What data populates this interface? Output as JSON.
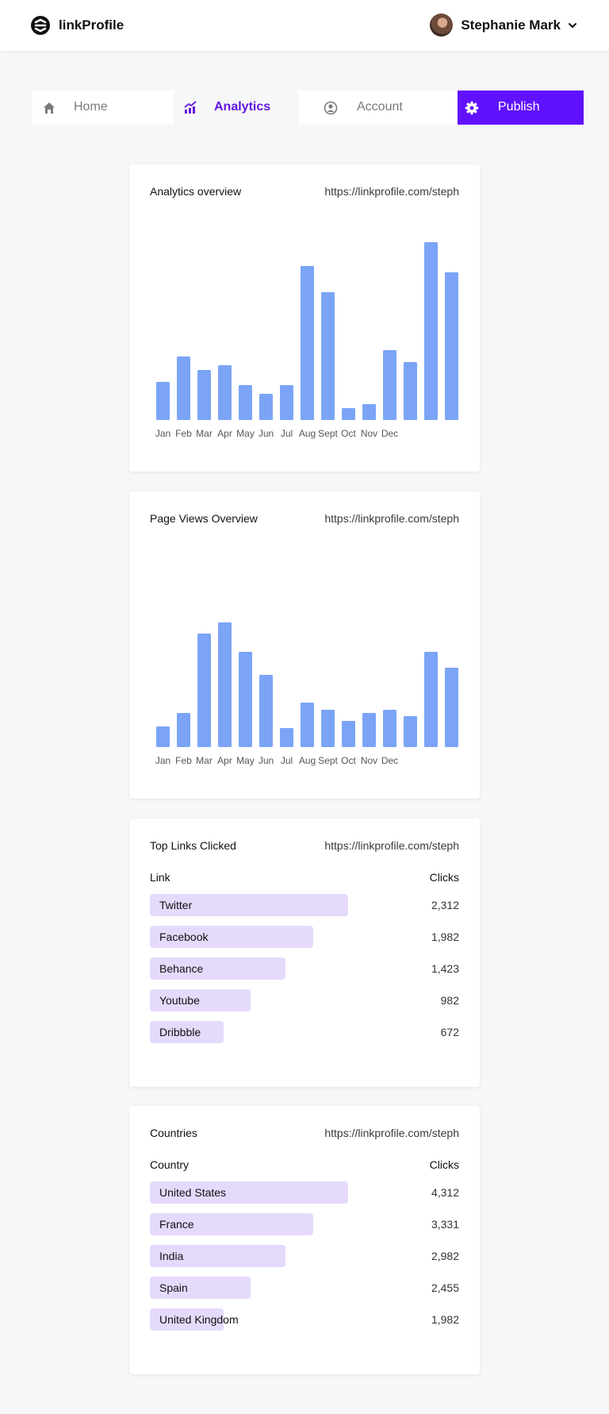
{
  "app": {
    "name": "linkProfile",
    "logo_icon": "linkprofile-logo-icon"
  },
  "user": {
    "name": "Stephanie Mark",
    "avatar_icon": "avatar",
    "menu_icon": "chevron-down-icon"
  },
  "nav": {
    "home": {
      "label": "Home",
      "icon": "home-icon"
    },
    "analytics": {
      "label": "Analytics",
      "icon": "analytics-icon"
    },
    "account": {
      "label": "Account",
      "icon": "user-circle-icon"
    },
    "publish": {
      "label": "Publish",
      "icon": "gear-icon"
    }
  },
  "colors": {
    "accent": "#6012ff",
    "bar": "#7ba4f6",
    "row_fill": "#e5dafc",
    "active_nav": "#6417e0"
  },
  "analytics_overview": {
    "title": "Analytics overview",
    "url": "https://linkprofile.com/steph"
  },
  "page_views": {
    "title": "Page Views Overview",
    "url": "https://linkprofile.com/steph"
  },
  "top_links": {
    "title": "Top Links Clicked",
    "url": "https://linkprofile.com/steph",
    "col_name": "Link",
    "col_value": "Clicks",
    "rows": [
      {
        "name": "Twitter",
        "value": "2,312"
      },
      {
        "name": "Facebook",
        "value": "1,982"
      },
      {
        "name": "Behance",
        "value": "1,423"
      },
      {
        "name": "Youtube",
        "value": "982"
      },
      {
        "name": "Dribbble",
        "value": "672"
      }
    ]
  },
  "countries": {
    "title": "Countries",
    "url": "https://linkprofile.com/steph",
    "col_name": "Country",
    "col_value": "Clicks",
    "rows": [
      {
        "name": "United States",
        "value": "4,312"
      },
      {
        "name": "France",
        "value": "3,331"
      },
      {
        "name": "India",
        "value": "2,982"
      },
      {
        "name": "Spain",
        "value": "2,455"
      },
      {
        "name": "United Kingdom",
        "value": "1,982"
      }
    ]
  },
  "chart_data": [
    {
      "type": "bar",
      "title": "Analytics overview",
      "categories": [
        "Jan",
        "Feb",
        "Mar",
        "Apr",
        "May",
        "Jun",
        "Jul",
        "Aug",
        "Sept",
        "Oct",
        "Nov",
        "Dec",
        ""
      ],
      "values": [
        48,
        80,
        63,
        69,
        44,
        33,
        44,
        194,
        161,
        15,
        20,
        88,
        73,
        224,
        186
      ],
      "ylim": [
        0,
        230
      ],
      "grid": false,
      "legend": "none"
    },
    {
      "type": "bar",
      "title": "Page Views Overview",
      "categories": [
        "Jan",
        "Feb",
        "Mar",
        "Apr",
        "May",
        "Jun",
        "Jul",
        "Aug",
        "Sept",
        "Oct",
        "Nov",
        "Dec",
        ""
      ],
      "values": [
        26,
        43,
        143,
        157,
        120,
        91,
        24,
        56,
        47,
        33,
        43,
        47,
        39,
        120,
        100
      ],
      "ylim": [
        0,
        230
      ],
      "grid": false,
      "legend": "none"
    }
  ]
}
